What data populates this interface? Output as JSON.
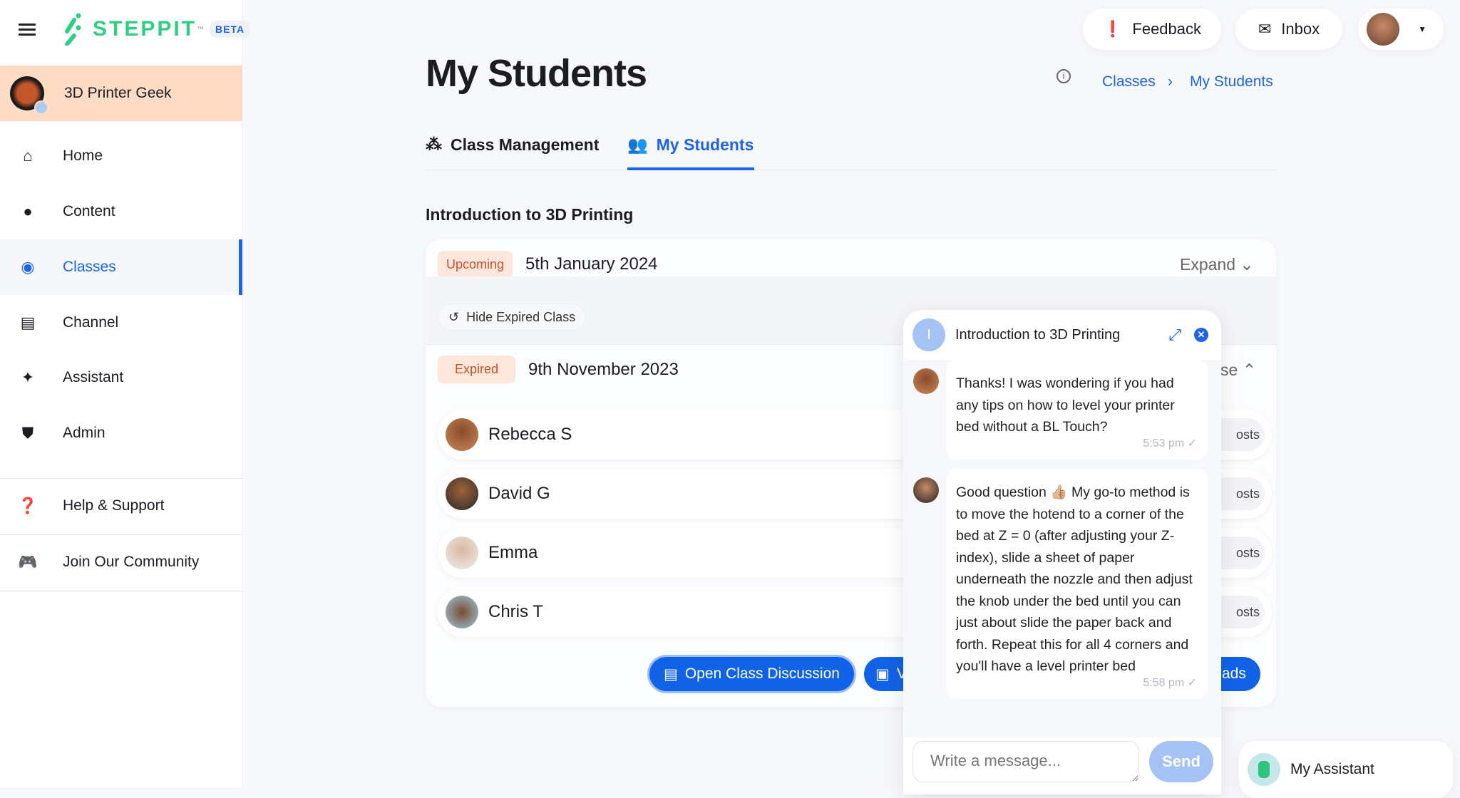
{
  "brand": {
    "name": "STEPPIT",
    "tm": "™",
    "badge": "BETA",
    "color": "#2fcf83"
  },
  "profile": {
    "name": "3D Printer Geek"
  },
  "sidebar": {
    "items": [
      {
        "label": "Home",
        "icon": "home-icon"
      },
      {
        "label": "Content",
        "icon": "content-icon"
      },
      {
        "label": "Classes",
        "icon": "classes-icon",
        "active": true
      },
      {
        "label": "Channel",
        "icon": "storefront-icon"
      },
      {
        "label": "Assistant",
        "icon": "sparkle-icon"
      },
      {
        "label": "Admin",
        "icon": "shield-icon"
      },
      {
        "label": "Help & Support",
        "icon": "help-icon"
      },
      {
        "label": "Join Our Community",
        "icon": "discord-icon"
      }
    ]
  },
  "header": {
    "feedback": "Feedback",
    "inbox": "Inbox"
  },
  "page": {
    "title": "My Students",
    "breadcrumb": [
      "Classes",
      "My Students"
    ]
  },
  "tabs": [
    {
      "label": "Class Management"
    },
    {
      "label": "My Students",
      "active": true
    }
  ],
  "section": {
    "title": "Introduction to 3D Printing"
  },
  "sessions": [
    {
      "status": "Upcoming",
      "date": "5th January 2024",
      "toggle": "Expand"
    },
    {
      "status": "Expired",
      "date": "9th November 2023",
      "toggle_partial": "se"
    }
  ],
  "hide_expired": "Hide Expired Class",
  "students": [
    {
      "name": "Rebecca S"
    },
    {
      "name": "David G"
    },
    {
      "name": "Emma"
    },
    {
      "name": "Chris T"
    }
  ],
  "student_action_partial": "osts",
  "actions": {
    "discussion": "Open Class Discussion",
    "second_partial": "V",
    "third_partial": "ads"
  },
  "chat": {
    "avatar_letter": "I",
    "title": "Introduction to 3D Printing",
    "messages": [
      {
        "text": "Thanks! I was wondering if you had any tips on how to level your printer bed without a BL Touch?",
        "time": "5:53 pm"
      },
      {
        "text": "Good question 👍🏼 My go-to method is to move the hotend to a corner of the bed at Z = 0 (after adjusting your Z-index), slide a sheet of paper underneath the nozzle and then adjust the knob under the bed until you can just about slide the paper back and forth. Repeat this for all 4 corners and you'll have a level printer bed",
        "time": "5:58 pm"
      }
    ],
    "placeholder": "Write a message...",
    "send": "Send"
  },
  "assistant": {
    "label": "My Assistant"
  },
  "colors": {
    "accent": "#1e63e9",
    "badge_bg": "#fde6dc",
    "badge_text": "#c5522a",
    "profile_bg": "#fddbc4"
  }
}
